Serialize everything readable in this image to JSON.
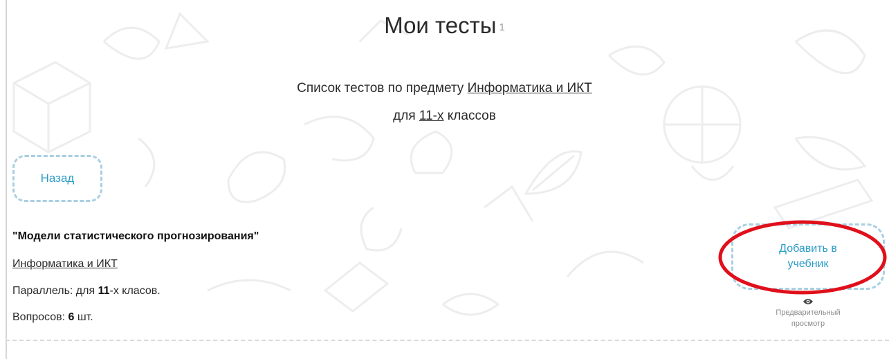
{
  "page": {
    "title": "Мои тесты",
    "title_count": "1",
    "subtitle_prefix": "Список тестов по предмету",
    "subject_link": "Информатика и ИКТ",
    "grade_prefix": "для",
    "grade_link": "11-х",
    "grade_suffix": "классов"
  },
  "back_button": {
    "label": "Назад"
  },
  "test": {
    "title": "\"Модели статистического прогнозирования\"",
    "subject": "Информатика и ИКТ",
    "parallel_prefix": "Параллель: для ",
    "parallel_value": "11",
    "parallel_suffix": "-х класов.",
    "questions_prefix": "Вопросов: ",
    "questions_value": "6",
    "questions_suffix": " шт.",
    "add_button_label": "Добавить в учебник",
    "preview_label": "Предварительный просмотр"
  },
  "colors": {
    "accent": "#2a9cc6",
    "button_border": "#a9cfe3",
    "highlight": "#e0101b",
    "doodle": "#ededed"
  },
  "icons": [
    "eye-icon"
  ]
}
